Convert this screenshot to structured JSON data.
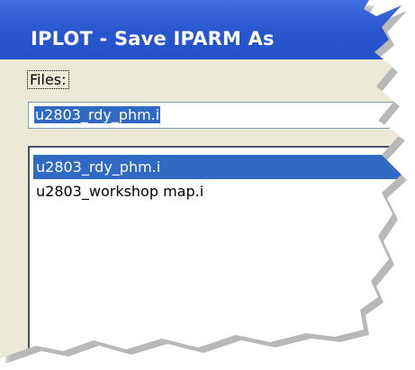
{
  "window": {
    "title": "IPLOT - Save IPARM As"
  },
  "files": {
    "label": "Files:",
    "filename_value": "u2803_rdy_phm.i",
    "items": [
      {
        "label": "u2803_rdy_phm.i",
        "selected": true
      },
      {
        "label": "u2803_workshop map.i",
        "selected": false
      }
    ]
  },
  "colors": {
    "titlebar": "#2452c8",
    "selection": "#316ac5",
    "dialog_background": "#ece9d8"
  }
}
